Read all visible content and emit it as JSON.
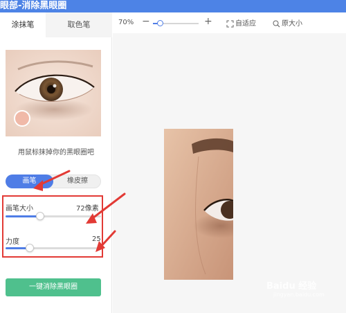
{
  "window": {
    "title": "眼部-消除黑眼圈"
  },
  "sidebar": {
    "tabs": [
      {
        "label": "涂抹笔",
        "active": true
      },
      {
        "label": "取色笔",
        "active": false
      }
    ],
    "hint": "用鼠标抹掉你的黑眼圈吧",
    "mode_toggle": {
      "brush_label": "画笔",
      "eraser_label": "橡皮擦",
      "selected": "画笔"
    },
    "brush_size": {
      "label": "画笔大小",
      "value_text": "72像素",
      "fraction": 0.36
    },
    "strength": {
      "label": "力度",
      "value_text": "25",
      "fraction": 0.25
    },
    "action_button": "一键消除黑眼圈"
  },
  "toolbar": {
    "zoom_percent": "70%",
    "zoom_fraction": 0.15,
    "fit_label": "自适应",
    "original_size_label": "原大小",
    "icons": {
      "minus": "minus-icon",
      "plus": "plus-icon",
      "fit": "fit-icon",
      "original": "magnifier-icon"
    }
  },
  "watermark": {
    "brand": "Baidu 经验",
    "sub": "jingyan.baidu.com"
  },
  "colors": {
    "titlebar": "#4d83e6",
    "accent_blue": "#4f7de6",
    "action_green": "#4fc08d",
    "annotation_red": "#e23a35"
  }
}
